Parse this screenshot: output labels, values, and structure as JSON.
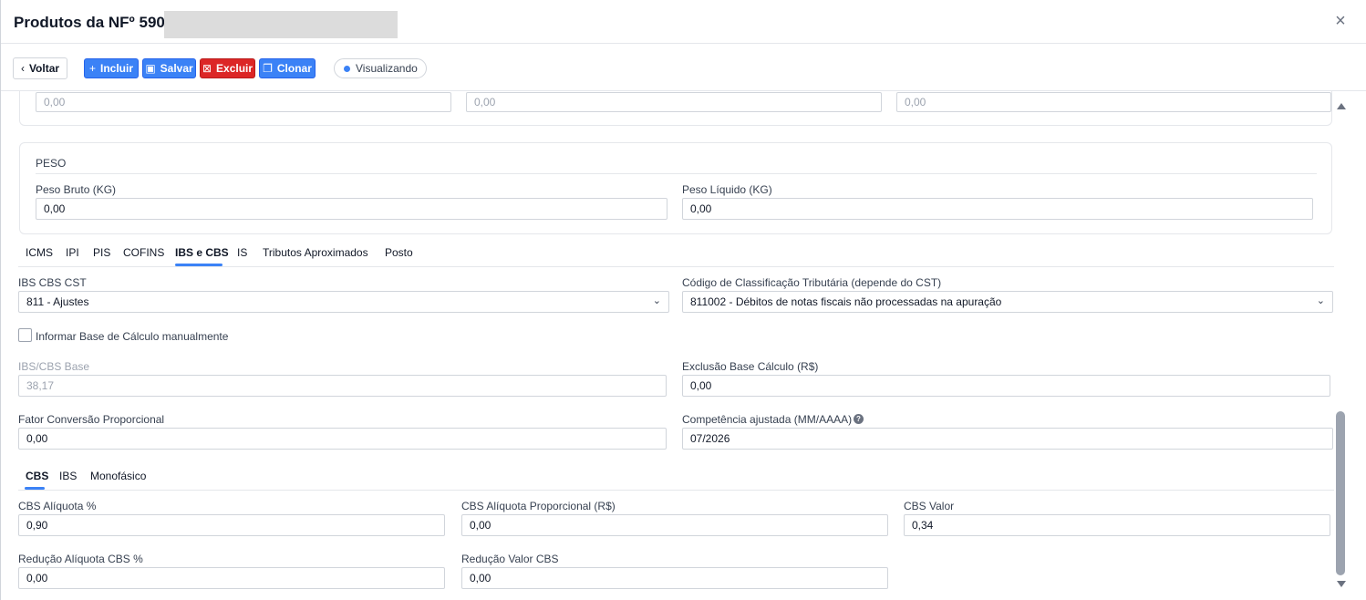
{
  "header": {
    "title": "Produtos da NFº 590 -",
    "close": "×"
  },
  "toolbar": {
    "back_label": "Voltar",
    "add_label": "Incluir",
    "save_label": "Salvar",
    "delete_label": "Excluir",
    "clone_label": "Clonar",
    "status_label": "Visualizando"
  },
  "top_card": {
    "values": [
      "0,00",
      "0,00",
      "0,00"
    ]
  },
  "peso": {
    "title": "PESO",
    "bruto_label": "Peso Bruto (KG)",
    "bruto_value": "0,00",
    "liquido_label": "Peso Líquido (KG)",
    "liquido_value": "0,00"
  },
  "tabs": [
    {
      "label": "ICMS"
    },
    {
      "label": "IPI"
    },
    {
      "label": "PIS"
    },
    {
      "label": "COFINS"
    },
    {
      "label": "IBS e CBS",
      "active": true
    },
    {
      "label": "IS"
    },
    {
      "label": "Tributos Aproximados"
    },
    {
      "label": "Posto"
    }
  ],
  "ibscbs": {
    "cst_label": "IBS CBS CST",
    "cst_value": "811 - Ajustes",
    "class_label": "Código de Classificação Tributária (depende do CST)",
    "class_value": "811002 - Débitos de notas fiscais não processadas na apuração",
    "manual_label": "Informar Base de Cálculo manualmente",
    "base_label": "IBS/CBS Base",
    "base_value": "38,17",
    "exclusao_label": "Exclusão Base Cálculo (R$)",
    "exclusao_value": "0,00",
    "fator_label": "Fator Conversão Proporcional",
    "fator_value": "0,00",
    "competencia_label": "Competência ajustada (MM/AAAA)",
    "competencia_value": "07/2026"
  },
  "subtabs": [
    {
      "label": "CBS",
      "active": true
    },
    {
      "label": "IBS"
    },
    {
      "label": "Monofásico"
    }
  ],
  "cbs": {
    "aliquota_label": "CBS Alíquota %",
    "aliquota_value": "0,90",
    "prop_label": "CBS Alíquota Proporcional (R$)",
    "prop_value": "0,00",
    "valor_label": "CBS Valor",
    "valor_value": "0,34",
    "red_aliq_label": "Redução Alíquota CBS %",
    "red_aliq_value": "0,00",
    "red_valor_label": "Redução Valor CBS",
    "red_valor_value": "0,00"
  },
  "colors": {
    "accent": "#3b82f6",
    "danger": "#dc2626"
  }
}
